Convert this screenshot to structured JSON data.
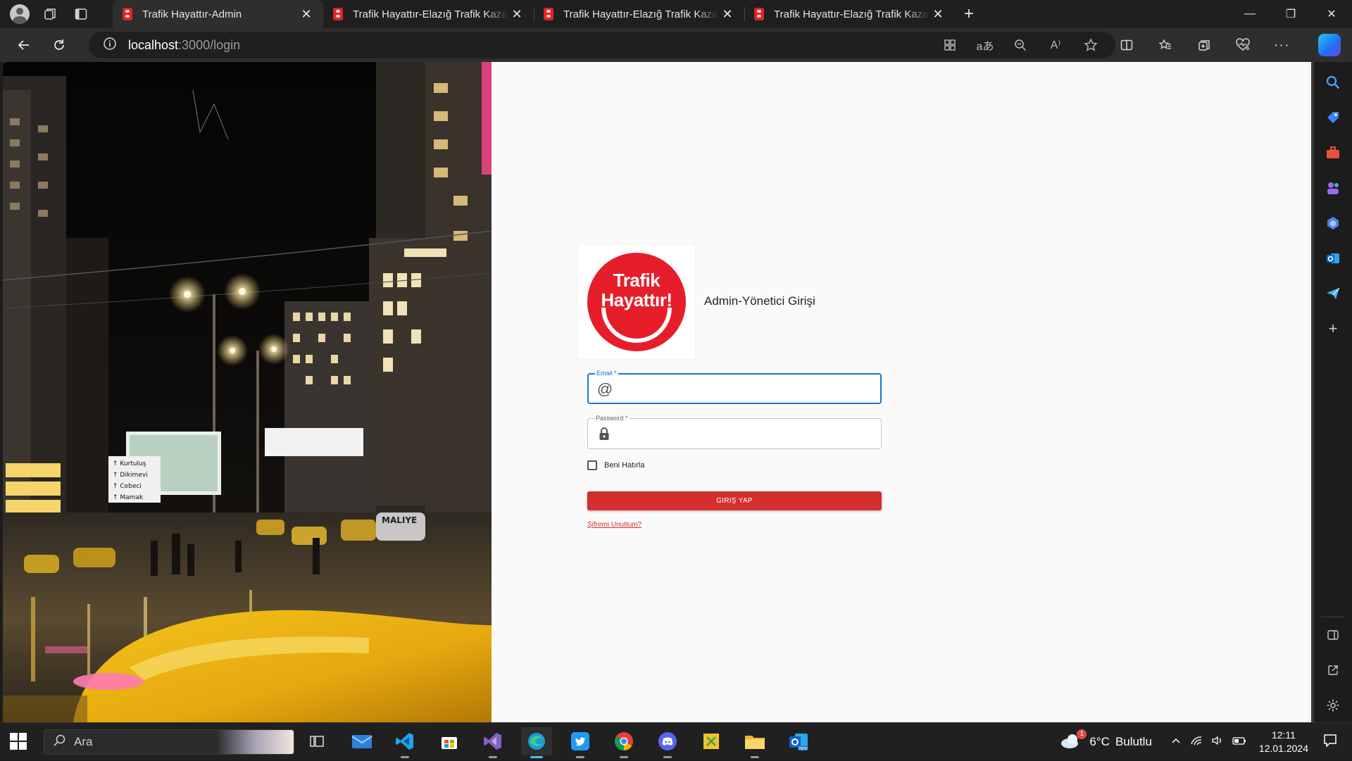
{
  "browser": {
    "tabs": [
      {
        "title": "Trafik Hayattır-Admin",
        "active": true
      },
      {
        "title": "Trafik Hayattır-Elazığ Trafik Kazas",
        "active": false
      },
      {
        "title": "Trafik Hayattır-Elazığ Trafik Kazas",
        "active": false
      },
      {
        "title": "Trafik Hayattır-Elazığ Trafik Kazas",
        "active": false
      }
    ],
    "url_host": "localhost",
    "url_path": ":3000/login"
  },
  "login": {
    "logo_line1": "Trafik",
    "logo_line2": "Hayattır!",
    "heading": "Admin-Yönetici Girişi",
    "email_label": "Email *",
    "email_value": "",
    "password_label": "Password *",
    "password_value": "",
    "remember_label": "Beni Hatırla",
    "remember_checked": false,
    "submit_label": "GIRIŞ YAP",
    "forgot_label": "Şifremi Unuttum?",
    "colors": {
      "primary": "#d32f2f",
      "focus": "#1976d2",
      "logo": "#e61e2a"
    }
  },
  "hero_sign": {
    "directions": [
      "Kurtuluş",
      "Dikimevi",
      "Cebeci",
      "Mamak"
    ],
    "taxi_sign": "MALIYE"
  },
  "taskbar": {
    "search_placeholder": "Ara",
    "weather_temp": "6°C",
    "weather_desc": "Bulutlu",
    "weather_badge": "1",
    "time": "12:11",
    "date": "12.01.2024",
    "apps": [
      "mail-icon",
      "vscode-icon",
      "store-icon",
      "visual-studio-icon",
      "edge-icon",
      "twitter-icon",
      "chrome-icon",
      "discord-icon",
      "sticky-tool-icon",
      "file-explorer-icon",
      "outlook-new-icon"
    ]
  }
}
